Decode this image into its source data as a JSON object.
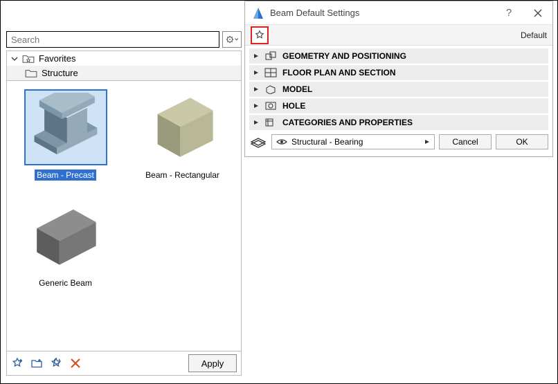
{
  "search": {
    "placeholder": "Search"
  },
  "tree": {
    "root": "Favorites",
    "child": "Structure"
  },
  "thumbs": [
    {
      "label": "Beam - Precast",
      "selected": true
    },
    {
      "label": "Beam - Rectangular",
      "selected": false
    },
    {
      "label": "Generic Beam",
      "selected": false
    }
  ],
  "leftFooter": {
    "apply": "Apply"
  },
  "dialog": {
    "title": "Beam Default Settings",
    "defaultLabel": "Default",
    "sections": [
      "GEOMETRY AND POSITIONING",
      "FLOOR PLAN AND SECTION",
      "MODEL",
      "HOLE",
      "CATEGORIES AND PROPERTIES"
    ],
    "layerSelect": "Structural - Bearing",
    "cancel": "Cancel",
    "ok": "OK"
  }
}
